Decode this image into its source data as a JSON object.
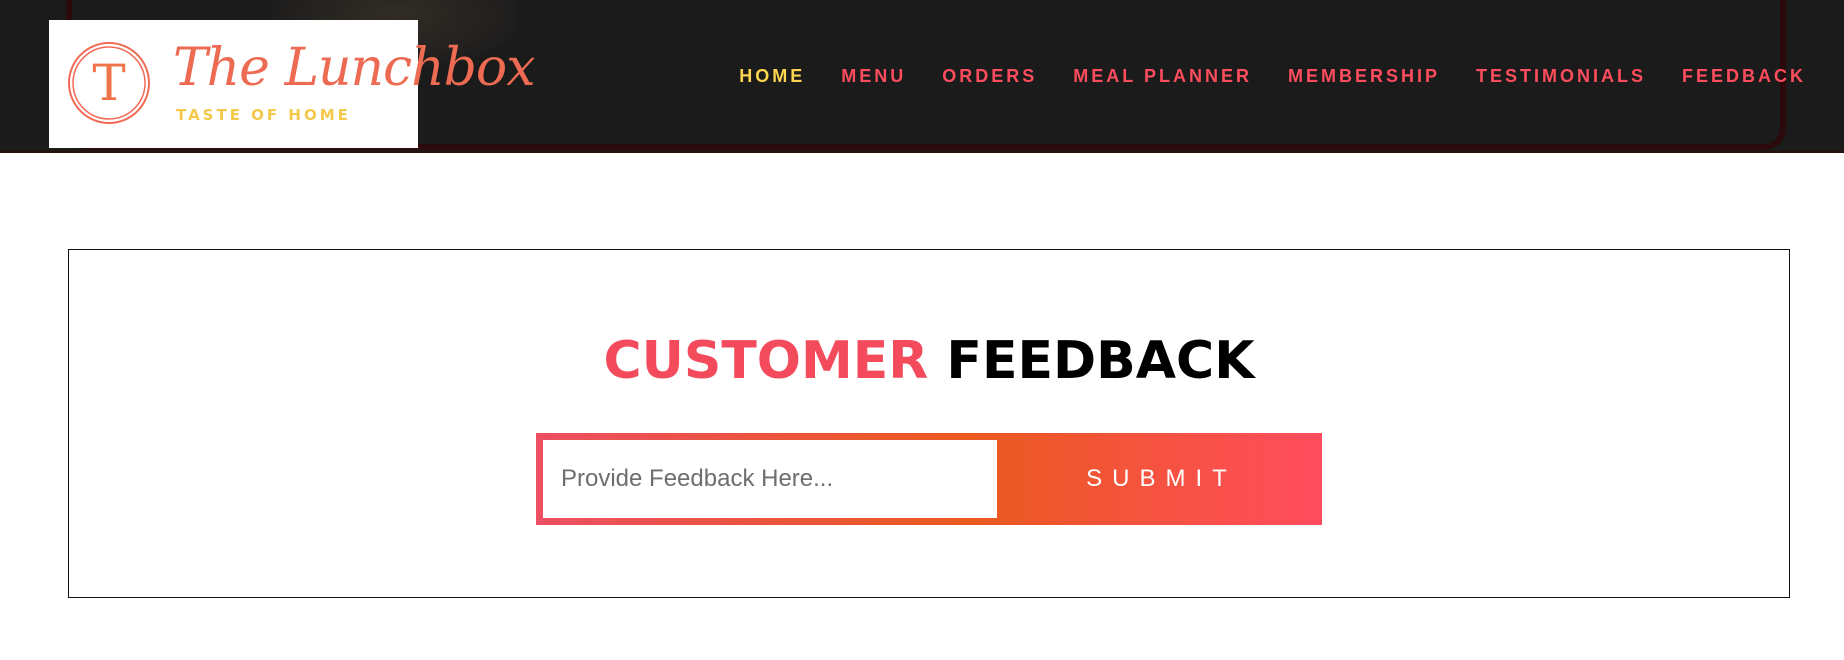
{
  "brand": {
    "name": "The Lunchbox",
    "tagline": "TASTE OF HOME",
    "logo_initial": "T",
    "colors": {
      "primary": "#f34b5c",
      "gold": "#fdd54f",
      "orange": "#ea5a1e"
    }
  },
  "nav": {
    "items": [
      {
        "label": "HOME",
        "active": true
      },
      {
        "label": "MENU",
        "active": false
      },
      {
        "label": "ORDERS",
        "active": false
      },
      {
        "label": "MEAL PLANNER",
        "active": false
      },
      {
        "label": "MEMBERSHIP",
        "active": false
      },
      {
        "label": "TESTIMONIALS",
        "active": false
      },
      {
        "label": "FEEDBACK",
        "active": false
      }
    ]
  },
  "feedback": {
    "title_accent": "CUSTOMER",
    "title_rest": "FEEDBACK",
    "input_placeholder": "Provide Feedback Here...",
    "input_value": "",
    "submit_label": "SUBMIT"
  }
}
